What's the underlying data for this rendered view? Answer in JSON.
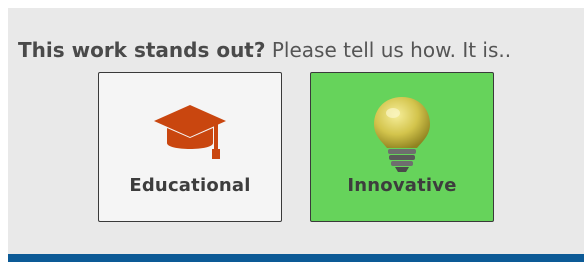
{
  "feedback": {
    "prompt_strong": "This work stands out?",
    "prompt_rest": " Please tell us how. It is.."
  },
  "options": [
    {
      "label": "Educational",
      "icon": "graduation-cap-icon",
      "selected": false,
      "icon_color": "#c9460f",
      "background": "#f5f5f5"
    },
    {
      "label": "Innovative",
      "icon": "lightbulb-icon",
      "selected": true,
      "icon_color": "#c4b43a",
      "background": "#66d35b"
    }
  ],
  "colors": {
    "panel_background": "#e9e9e9",
    "bottom_bar": "#0c5a96"
  }
}
